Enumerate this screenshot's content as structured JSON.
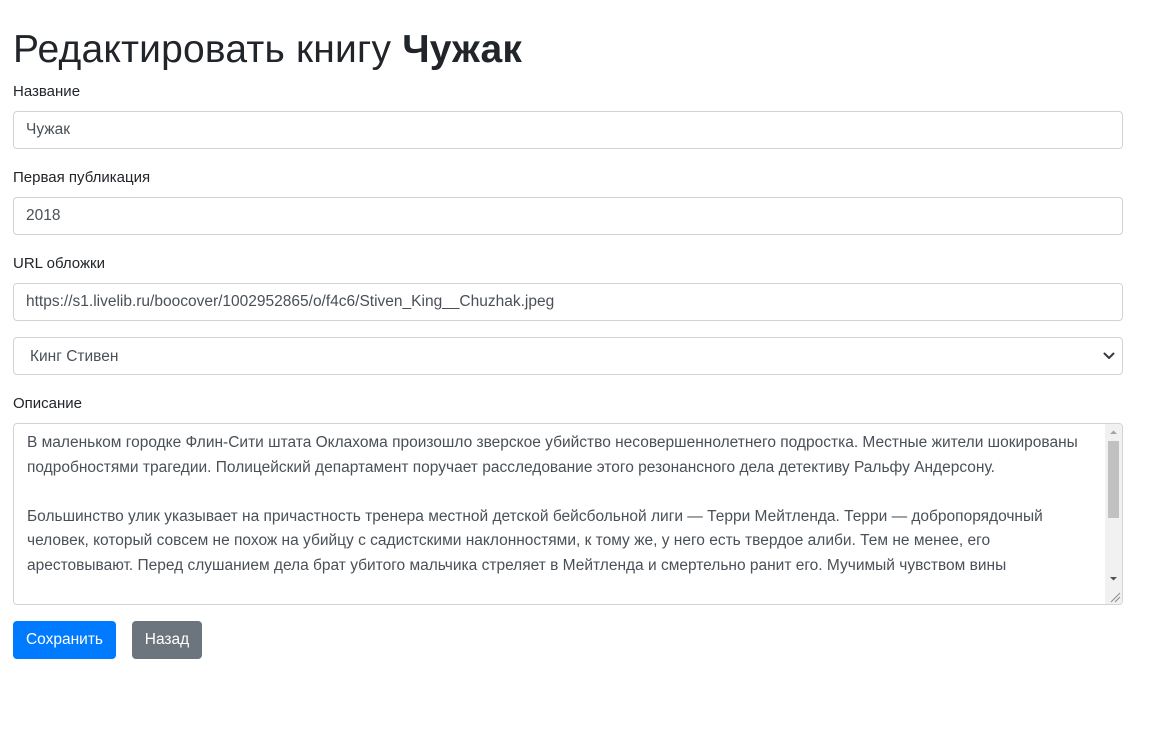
{
  "page": {
    "title_prefix": "Редактировать книгу",
    "title_book": "Чужак"
  },
  "form": {
    "name_label": "Название",
    "name_value": "Чужак",
    "year_label": "Первая публикация",
    "year_value": "2018",
    "cover_label": "URL обложки",
    "cover_value": "https://s1.livelib.ru/boocover/1002952865/o/f4c6/Stiven_King__Chuzhak.jpeg",
    "author_selected": "Кинг Стивен",
    "description_label": "Описание",
    "description_value": "В маленьком городке Флин-Сити штата Оклахома произошло зверское убийство несовершеннолетнего подростка. Местные жители шокированы подробностями трагедии. Полицейский департамент поручает расследование этого резонансного дела детективу Ральфу Андерсону.\n\nБольшинство улик указывает на причастность тренера местной детской бейсбольной лиги — Терри Мейтленда. Терри — добропорядочный человек, который совсем не похож на убийцу с садистскими наклонностями, к тому же, у него есть твердое алиби. Тем не менее, его арестовывают. Перед слушанием дела брат убитого мальчика стреляет в Мейтленда и смертельно ранит его. Мучимый чувством вины"
  },
  "buttons": {
    "save_label": "Сохранить",
    "back_label": "Назад"
  },
  "colors": {
    "primary": "#007bff",
    "secondary": "#6c757d",
    "border": "#ced4da",
    "text": "#212529"
  }
}
